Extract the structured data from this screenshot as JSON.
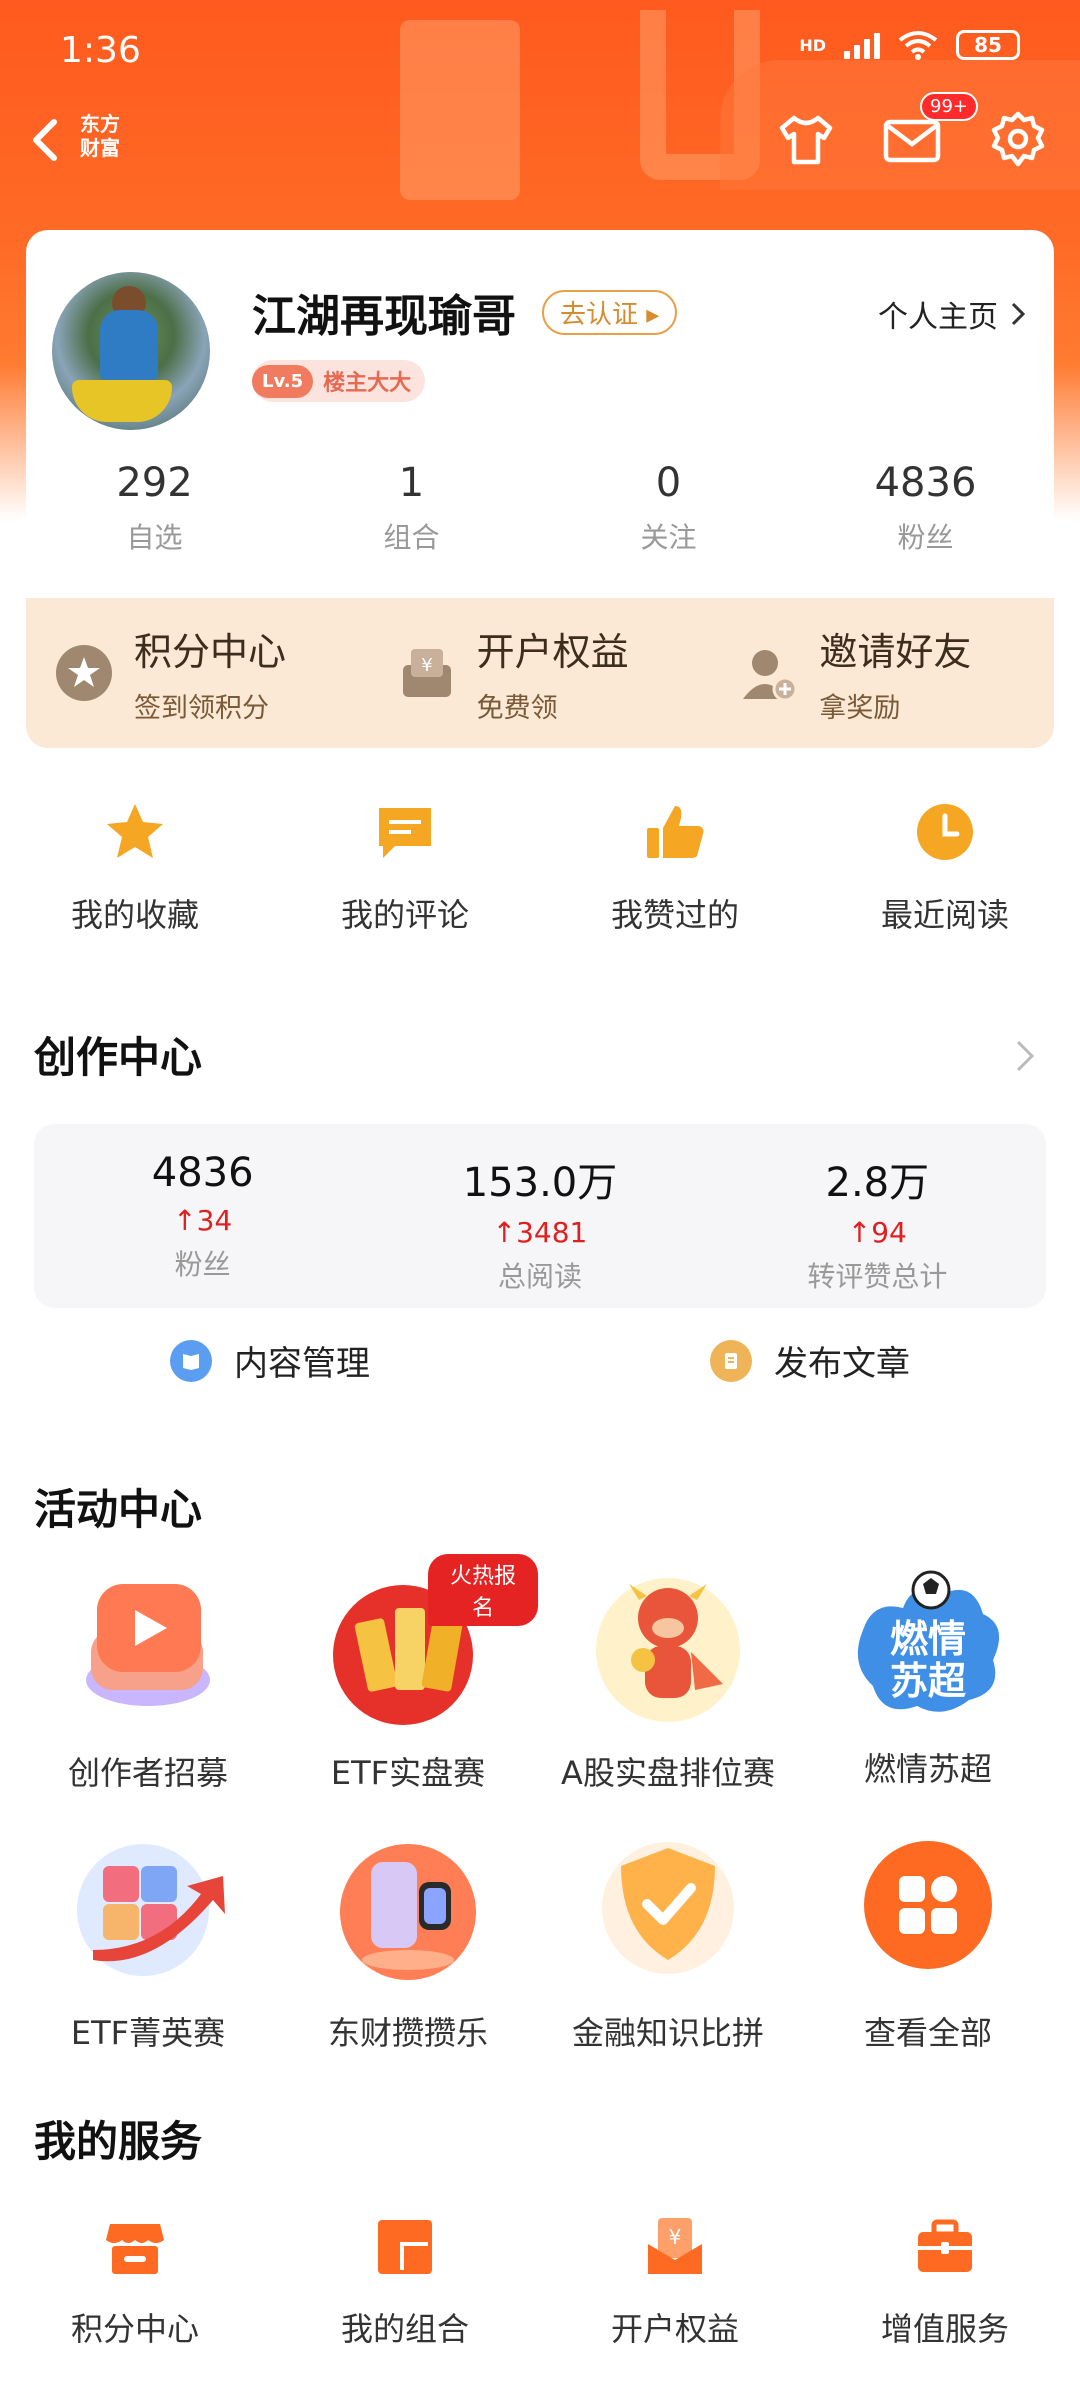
{
  "status": {
    "time": "1:36",
    "network": "HD",
    "battery": "85"
  },
  "header": {
    "logo_line1": "东方",
    "logo_line2": "财富",
    "mail_badge": "99+"
  },
  "profile": {
    "username": "江湖再现瑜哥",
    "verify_label": "去认证 ▸",
    "level": "Lv.5",
    "level_title": "楼主大大",
    "homepage_label": "个人主页",
    "stats": [
      {
        "num": "292",
        "label": "自选"
      },
      {
        "num": "1",
        "label": "组合"
      },
      {
        "num": "0",
        "label": "关注"
      },
      {
        "num": "4836",
        "label": "粉丝"
      }
    ]
  },
  "benefits": [
    {
      "title": "积分中心",
      "sub": "签到领积分"
    },
    {
      "title": "开户权益",
      "sub": "免费领"
    },
    {
      "title": "邀请好友",
      "sub": "拿奖励"
    }
  ],
  "quick": [
    {
      "label": "我的收藏"
    },
    {
      "label": "我的评论"
    },
    {
      "label": "我赞过的"
    },
    {
      "label": "最近阅读"
    }
  ],
  "creation": {
    "title": "创作中心",
    "stats": [
      {
        "num": "4836",
        "up": "34",
        "label": "粉丝"
      },
      {
        "num": "153.0万",
        "up": "3481",
        "label": "总阅读"
      },
      {
        "num": "2.8万",
        "up": "94",
        "label": "转评赞总计"
      }
    ],
    "actions": [
      {
        "label": "内容管理"
      },
      {
        "label": "发布文章"
      }
    ]
  },
  "activity": {
    "title": "活动中心",
    "hot_badge": "火热报名",
    "row1": [
      {
        "label": "创作者招募"
      },
      {
        "label": "ETF实盘赛"
      },
      {
        "label": "A股实盘排位赛"
      },
      {
        "label": "燃情苏超",
        "art_text1": "燃情",
        "art_text2": "苏超"
      }
    ],
    "row2": [
      {
        "label": "ETF菁英赛"
      },
      {
        "label": "东财攒攒乐"
      },
      {
        "label": "金融知识比拼"
      },
      {
        "label": "查看全部"
      }
    ]
  },
  "services": {
    "title": "我的服务",
    "items": [
      {
        "label": "积分中心"
      },
      {
        "label": "我的组合"
      },
      {
        "label": "开户权益"
      },
      {
        "label": "增值服务"
      }
    ]
  },
  "colors": {
    "brand": "#ff5a1f",
    "accent": "#f5a623",
    "up": "#e02020"
  }
}
